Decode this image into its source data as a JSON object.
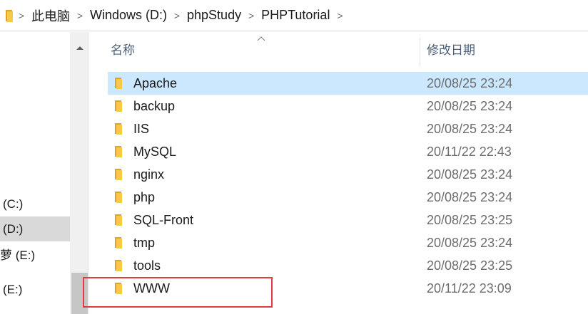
{
  "addressbar": {
    "breadcrumbs": [
      "此电脑",
      "Windows (D:)",
      "phpStudy",
      "PHPTutorial"
    ],
    "separator": ">",
    "trailing_separator": ">"
  },
  "navpane": {
    "items": [
      {
        "label": "(C:)",
        "selected": false
      },
      {
        "label": "(D:)",
        "selected": true
      },
      {
        "label": "萝 (E:)",
        "selected": false
      },
      {
        "label": "(E:)",
        "selected": false
      }
    ]
  },
  "columns": {
    "name": "名称",
    "date_modified": "修改日期",
    "sort_indicator": "^"
  },
  "files": [
    {
      "name": "Apache",
      "date": "20/08/25 23:24",
      "selected": true
    },
    {
      "name": "backup",
      "date": "20/08/25 23:24",
      "selected": false
    },
    {
      "name": "IIS",
      "date": "20/08/25 23:24",
      "selected": false
    },
    {
      "name": "MySQL",
      "date": "20/11/22 22:43",
      "selected": false
    },
    {
      "name": "nginx",
      "date": "20/08/25 23:24",
      "selected": false
    },
    {
      "name": "php",
      "date": "20/08/25 23:24",
      "selected": false
    },
    {
      "name": "SQL-Front",
      "date": "20/08/25 23:25",
      "selected": false
    },
    {
      "name": "tmp",
      "date": "20/08/25 23:24",
      "selected": false
    },
    {
      "name": "tools",
      "date": "20/08/25 23:25",
      "selected": false
    },
    {
      "name": "WWW",
      "date": "20/11/22 23:09",
      "selected": false
    }
  ],
  "colors": {
    "folder_yellow": "#f7c948",
    "folder_yellow_dark": "#e0a526",
    "selection_blue": "#cce8ff",
    "highlight_red": "#e23c3c"
  },
  "icons": {
    "folder": "folder-icon",
    "sort": "sort-ascending-icon",
    "scroll_up": "chevron-up-icon",
    "breadcrumb_separator": "chevron-right-icon"
  }
}
